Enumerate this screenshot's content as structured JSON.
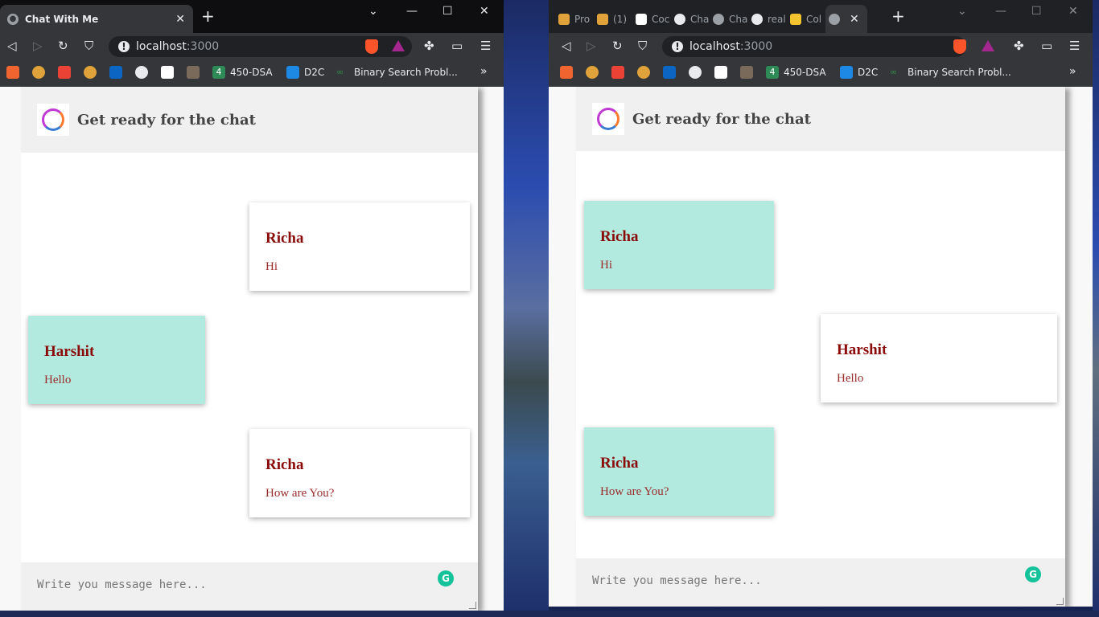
{
  "left_window": {
    "tab_title": "Chat With Me",
    "url_host": "localhost",
    "url_port": ":3000"
  },
  "right_window": {
    "tabs": [
      "Pro",
      "(1)",
      "Coc",
      "Cha",
      "Cha",
      "real",
      "Col",
      ""
    ],
    "url_host": "localhost",
    "url_port": ":3000"
  },
  "bookmarks": {
    "item_450dsa": "450-DSA",
    "item_450dsa_badge": "4",
    "item_d2c": "D2C",
    "item_binary": "Binary Search Probl...",
    "more": "»"
  },
  "chat": {
    "header_title": "Get ready for the chat",
    "placeholder": "Write you message here...",
    "left_messages": [
      {
        "sender": "Richa",
        "text": "Hi",
        "side": "right"
      },
      {
        "sender": "Harshit",
        "text": "Hello",
        "side": "left"
      },
      {
        "sender": "Richa",
        "text": "How are You?",
        "side": "right"
      }
    ],
    "right_messages": [
      {
        "sender": "Richa",
        "text": "Hi",
        "side": "left"
      },
      {
        "sender": "Harshit",
        "text": "Hello",
        "side": "right"
      },
      {
        "sender": "Richa",
        "text": "How are You?",
        "side": "left"
      }
    ]
  },
  "colors": {
    "incoming_bubble": "#b3eae0",
    "outgoing_bubble": "#ffffff",
    "sender_name": "#8b0a0a",
    "message_text": "#9b2c2c"
  }
}
